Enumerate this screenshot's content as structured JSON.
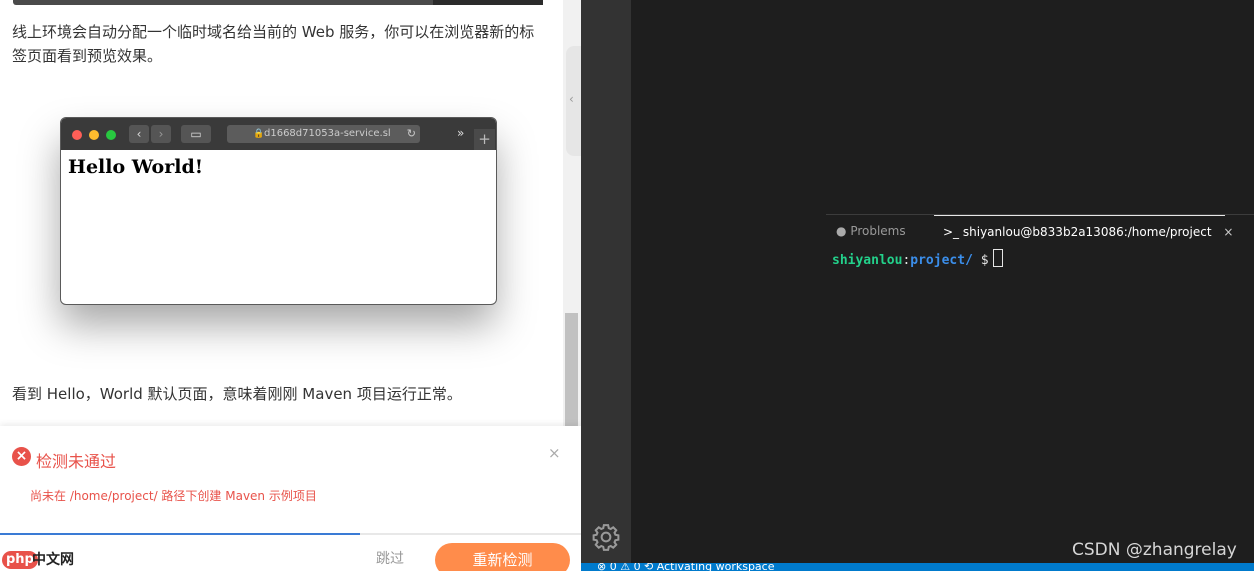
{
  "doc": {
    "paragraph_1": "线上环境会自动分配一个临时域名给当前的 Web 服务，你可以在浏览器新的标签页面看到预览效果。",
    "paragraph_2": "看到 Hello，World 默认页面，意味着刚刚 Maven 项目运行正常。"
  },
  "browser_mock": {
    "address": "d1668d71053a-service.sl",
    "heading": "Hello World!",
    "more": "»",
    "newtab": "+"
  },
  "check_panel": {
    "title": "检测未通过",
    "detail": "尚未在 /home/project/ 路径下创建 Maven 示例项目",
    "close": "×",
    "skip_label": "跳过",
    "recheck_label": "重新检测",
    "progress": 0.62,
    "watermark_php": "php",
    "watermark_tail": "中文网"
  },
  "ide": {
    "tabs": {
      "problems": "Problems",
      "terminal": "shiyanlou@b833b2a13086:/home/project"
    },
    "terminal": {
      "user": "shiyanlou",
      "path": "project/",
      "symbol": "$"
    },
    "status_text": "⊗ 0 ⚠ 0  ⟲ Activating workspace"
  },
  "watermark": "CSDN @zhangrelay",
  "colors": {
    "error": "#e8524a",
    "accent": "#ff8c4b",
    "status_bar": "#007acc"
  },
  "icons": [
    "error-circle-icon",
    "close-icon",
    "gear-icon",
    "terminal-icon",
    "info-icon",
    "lock-icon",
    "reload-icon"
  ]
}
